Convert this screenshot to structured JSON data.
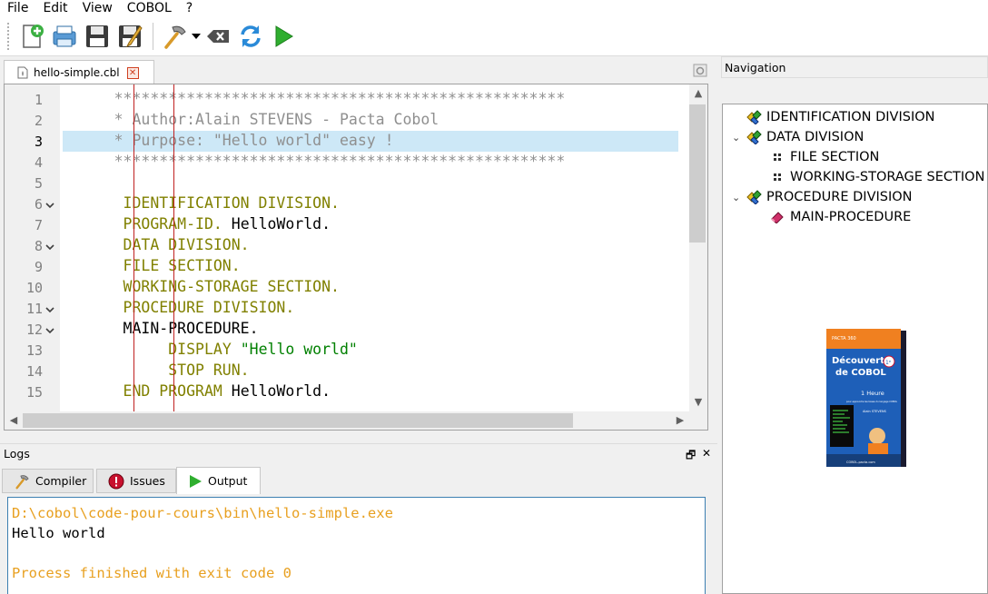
{
  "menu": [
    "File",
    "Edit",
    "View",
    "COBOL",
    "?"
  ],
  "toolbar": {
    "icons": [
      "new-file-icon",
      "print-icon",
      "save-icon",
      "save-as-icon",
      "build-icon",
      "dropdown-icon",
      "clear-icon",
      "refresh-icon",
      "run-icon"
    ]
  },
  "editor": {
    "tab_label": "hello-simple.cbl",
    "tab_close": "✕",
    "lines": [
      {
        "n": "1",
        "text": "      **************************************************",
        "cls": "c-comment"
      },
      {
        "n": "2",
        "text": "      * Author:Alain STEVENS - Pacta Cobol",
        "cls": "c-comment"
      },
      {
        "n": "3",
        "text": "      * Purpose: \"Hello world\" easy !",
        "cls": "c-comment"
      },
      {
        "n": "4",
        "text": "      **************************************************",
        "cls": "c-comment"
      },
      {
        "n": "5",
        "text": "",
        "cls": "c-plain"
      },
      {
        "n": "6",
        "text": "       IDENTIFICATION DIVISION.",
        "cls": "c-kw"
      },
      {
        "n": "7",
        "text": "       PROGRAM-ID. HelloWorld.",
        "cls": "mixed1"
      },
      {
        "n": "8",
        "text": "       DATA DIVISION.",
        "cls": "c-kw"
      },
      {
        "n": "9",
        "text": "       FILE SECTION.",
        "cls": "c-kw"
      },
      {
        "n": "10",
        "text": "       WORKING-STORAGE SECTION.",
        "cls": "c-kw"
      },
      {
        "n": "11",
        "text": "       PROCEDURE DIVISION.",
        "cls": "c-kw"
      },
      {
        "n": "12",
        "text": "       MAIN-PROCEDURE.",
        "cls": "c-plain"
      },
      {
        "n": "13",
        "text": "            DISPLAY \"Hello world\"",
        "cls": "mixed2"
      },
      {
        "n": "14",
        "text": "            STOP RUN.",
        "cls": "c-kw"
      },
      {
        "n": "15",
        "text": "       END PROGRAM HelloWorld.",
        "cls": "mixed3"
      }
    ],
    "folds": [
      "6",
      "8",
      "11",
      "12"
    ],
    "current_line": "3"
  },
  "logs": {
    "title": "Logs",
    "float_glyph": "🗗",
    "close_glyph": "✕",
    "tabs": [
      {
        "label": "Compiler",
        "icon": "compiler-icon"
      },
      {
        "label": "Issues",
        "icon": "issues-icon"
      },
      {
        "label": "Output",
        "icon": "output-icon",
        "active": true
      }
    ],
    "output": [
      {
        "text": "D:\\cobol\\code-pour-cours\\bin\\hello-simple.exe",
        "color": "orange"
      },
      {
        "text": "Hello world",
        "color": "black"
      },
      {
        "text": "",
        "color": "black"
      },
      {
        "text": "Process finished with exit code 0",
        "color": "orange"
      }
    ]
  },
  "navigation": {
    "title": "Navigation",
    "tree": [
      {
        "label": "IDENTIFICATION DIVISION",
        "level": 0,
        "arrow": "",
        "icon": "division-icon"
      },
      {
        "label": "DATA DIVISION",
        "level": 0,
        "arrow": "⌄",
        "icon": "division-icon"
      },
      {
        "label": "FILE SECTION",
        "level": 1,
        "arrow": "",
        "icon": "section-icon"
      },
      {
        "label": "WORKING-STORAGE SECTION",
        "level": 1,
        "arrow": "",
        "icon": "section-icon"
      },
      {
        "label": "PROCEDURE DIVISION",
        "level": 0,
        "arrow": "⌄",
        "icon": "division-icon"
      },
      {
        "label": "MAIN-PROCEDURE",
        "level": 1,
        "arrow": "",
        "icon": "paragraph-icon"
      }
    ],
    "book": {
      "brand": "PACTA 360",
      "title_line1": "Découverte",
      "title_line2": "de COBOL",
      "badge": "1ᵉ",
      "duration": "1 Heure",
      "subtitle": "pour apprendre les bases du langage COBOL",
      "author": "Alain STEVENS",
      "footer": "COBOL-pacta.com"
    }
  }
}
